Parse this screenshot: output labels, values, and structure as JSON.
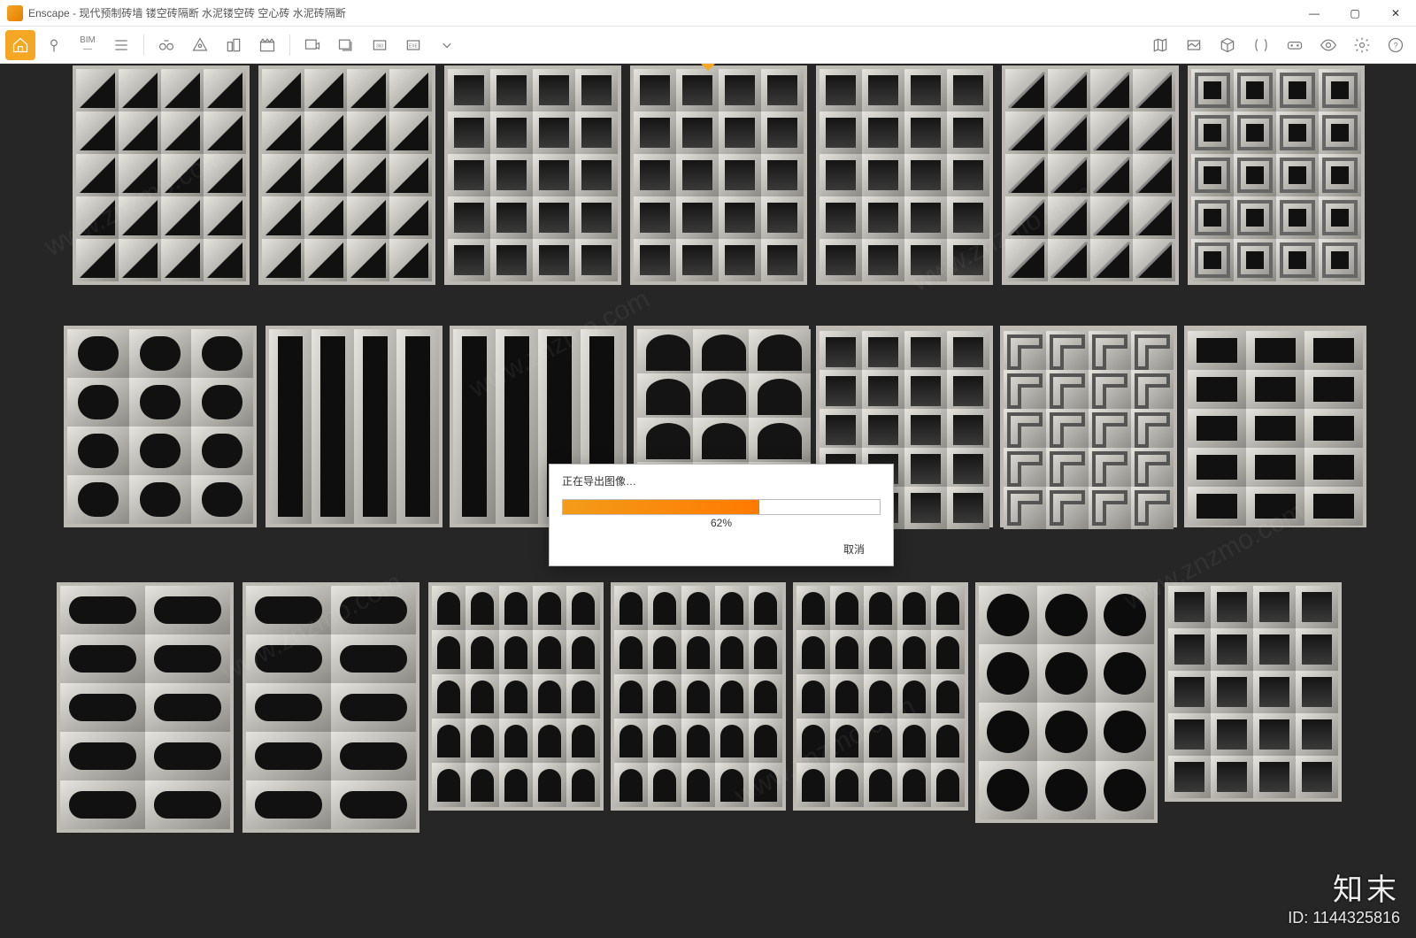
{
  "window": {
    "app": "Enscape",
    "title": "Enscape - 现代预制砖墙 镂空砖隔断 水泥镂空砖 空心砖 水泥砖隔断"
  },
  "window_controls": {
    "minimize": "—",
    "maximize": "▢",
    "close": "✕"
  },
  "toolbar": {
    "left": [
      {
        "name": "home-icon",
        "label": "Home"
      },
      {
        "name": "pin-icon",
        "label": "Pin"
      },
      {
        "name": "bim-label",
        "label": "BIM"
      },
      {
        "name": "menu-icon",
        "label": "Menu"
      },
      {
        "name": "binoculars-icon",
        "label": "Views"
      },
      {
        "name": "sun-icon",
        "label": "Sun"
      },
      {
        "name": "buildings-icon",
        "label": "Assets"
      },
      {
        "name": "clapper-icon",
        "label": "Video"
      }
    ],
    "mid": [
      {
        "name": "export-image-icon",
        "label": "Export Image"
      },
      {
        "name": "batch-export-icon",
        "label": "Batch Export"
      },
      {
        "name": "pano-360-icon",
        "label": "360"
      },
      {
        "name": "exe-export-icon",
        "label": "EXE"
      },
      {
        "name": "chevron-down-icon",
        "label": "More"
      }
    ],
    "right": [
      {
        "name": "map-icon",
        "label": "Map"
      },
      {
        "name": "site-icon",
        "label": "Site"
      },
      {
        "name": "cube-icon",
        "label": "3D"
      },
      {
        "name": "compare-icon",
        "label": "Compare"
      },
      {
        "name": "vr-icon",
        "label": "VR"
      },
      {
        "name": "eye-icon",
        "label": "Visibility"
      },
      {
        "name": "gear-icon",
        "label": "Settings"
      },
      {
        "name": "help-icon",
        "label": "Help"
      }
    ]
  },
  "dialog": {
    "title": "正在导出图像…",
    "percent_value": 62,
    "percent_label": "62%",
    "cancel": "取消"
  },
  "watermark": {
    "brand": "知末",
    "id_label": "ID: 1144325816",
    "diag": "www.znzmo.com"
  },
  "scene_description": "Rendered catalogue of 21 concrete breeze-block / screen-wall panel designs arranged in three rows on a dark background."
}
